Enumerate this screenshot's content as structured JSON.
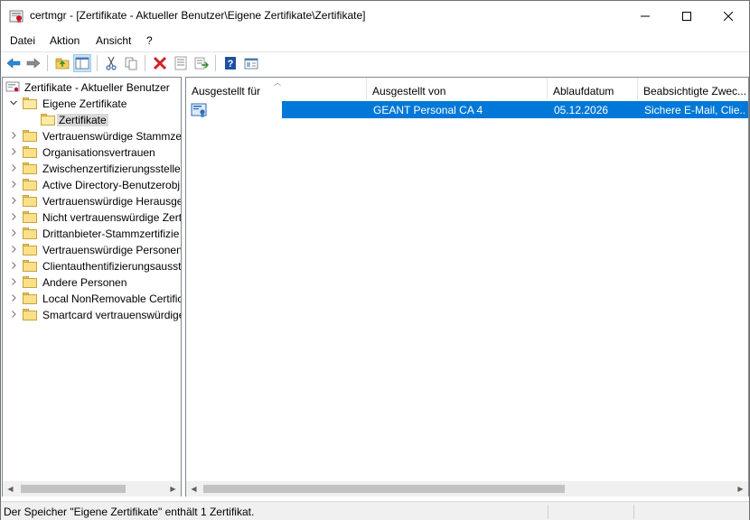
{
  "window": {
    "title": "certmgr - [Zertifikate - Aktueller Benutzer\\Eigene Zertifikate\\Zertifikate]",
    "minimize_glyph": "—",
    "maximize_glyph": "☐",
    "close_glyph": "✕"
  },
  "menu": {
    "items": [
      "Datei",
      "Aktion",
      "Ansicht",
      "?"
    ]
  },
  "toolbar": {
    "buttons": [
      "back-icon",
      "forward-icon",
      "up-folder-icon",
      "show-hide-tree-icon",
      "cut-icon",
      "copy-icon",
      "delete-icon",
      "properties-icon",
      "export-list-icon",
      "help-icon",
      "console-view-icon"
    ]
  },
  "tree": {
    "root": "Zertifikate - Aktueller Benutzer",
    "items": [
      {
        "label": "Eigene Zertifikate",
        "expanded": true
      },
      {
        "label": "Zertifikate",
        "selected": true
      },
      {
        "label": "Vertrauenswürdige Stammzer"
      },
      {
        "label": "Organisationsvertrauen"
      },
      {
        "label": "Zwischenzertifizierungsstellen"
      },
      {
        "label": "Active Directory-Benutzerobj"
      },
      {
        "label": "Vertrauenswürdige Herausgeb"
      },
      {
        "label": "Nicht vertrauenswürdige Zert"
      },
      {
        "label": "Drittanbieter-Stammzertifizie"
      },
      {
        "label": "Vertrauenswürdige Personen"
      },
      {
        "label": "Clientauthentifizierungsausst"
      },
      {
        "label": "Andere Personen"
      },
      {
        "label": "Local NonRemovable Certific"
      },
      {
        "label": "Smartcard vertrauenswürdige"
      }
    ]
  },
  "list": {
    "columns": [
      "Ausgestellt für",
      "Ausgestellt von",
      "Ablaufdatum",
      "Beabsichtigte Zwec..."
    ],
    "rows": [
      {
        "issued_to": "",
        "issued_by": "GEANT Personal CA 4",
        "expires": "05.12.2026",
        "purposes": "Sichere E-Mail, Clie..."
      }
    ]
  },
  "status": {
    "text": "Der Speicher \"Eigene Zertifikate\" enthält 1 Zertifikat."
  },
  "colors": {
    "selection": "#0078d7",
    "tree_selection": "#d9d9d9",
    "folder": "#fbe08a"
  }
}
